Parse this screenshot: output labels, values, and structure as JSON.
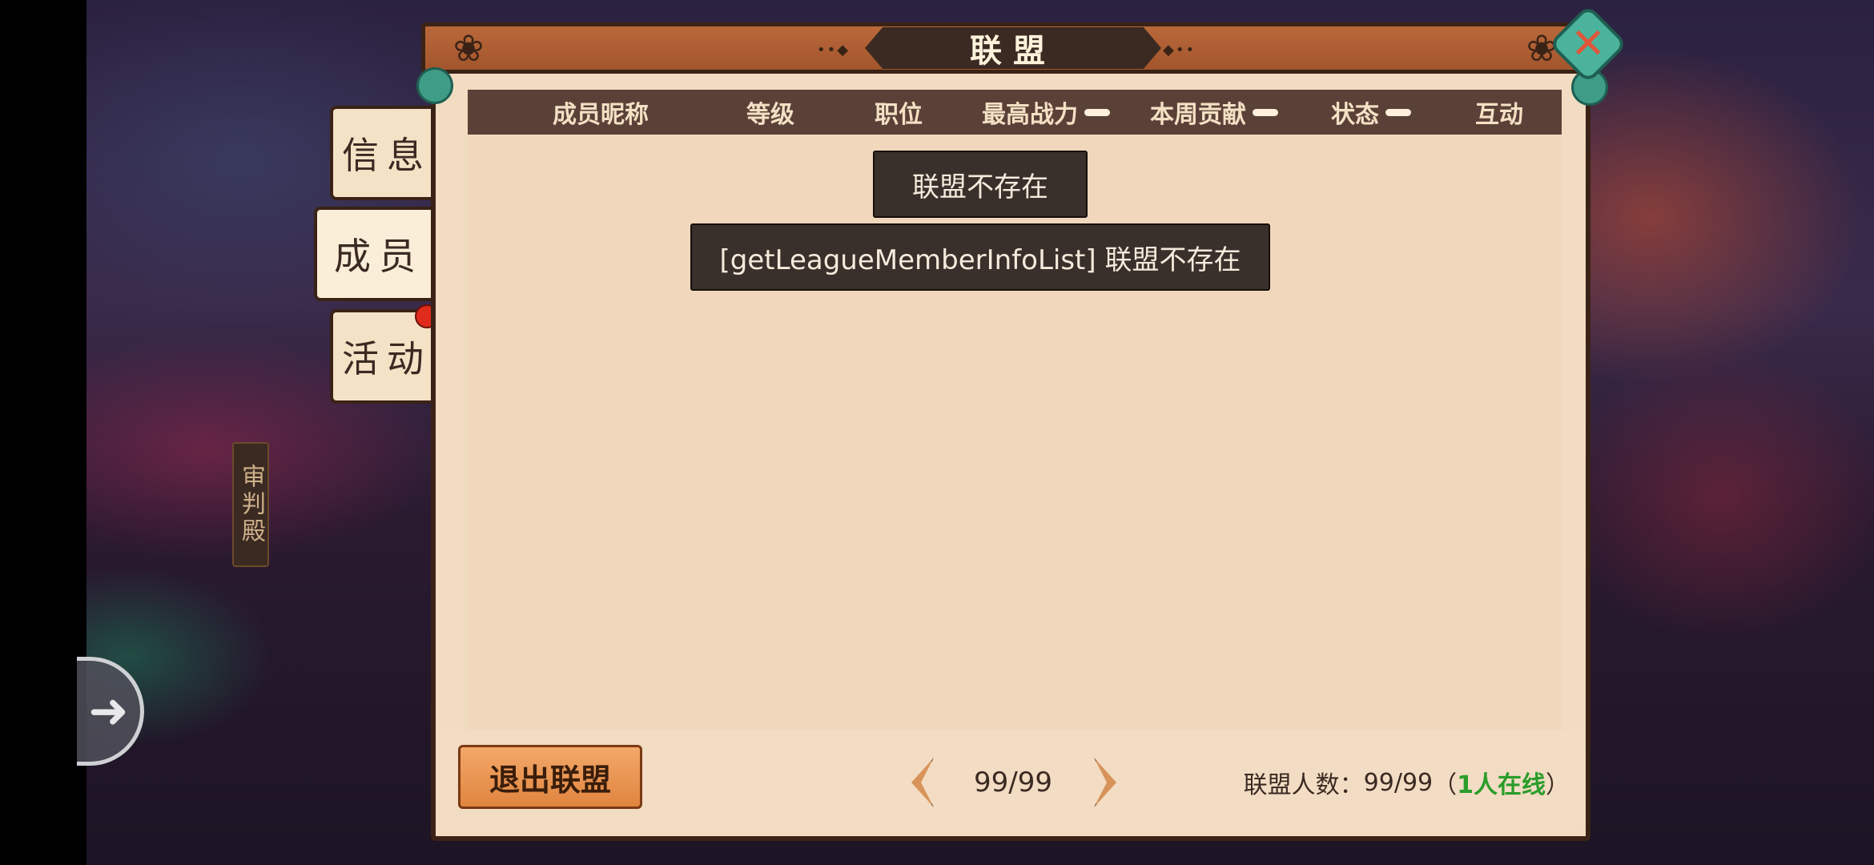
{
  "window": {
    "title": "联盟"
  },
  "side_tabs": [
    {
      "label": "信息",
      "active": false
    },
    {
      "label": "成员",
      "active": true
    },
    {
      "label": "活动",
      "active": false,
      "has_notification": true
    }
  ],
  "world_label": "审判殿",
  "table": {
    "columns": [
      "成员昵称",
      "等级",
      "职位",
      "最高战力",
      "本周贡献",
      "状态",
      "互动"
    ],
    "sortable_columns": [
      "最高战力",
      "本周贡献",
      "状态"
    ],
    "rows": []
  },
  "toasts": [
    "联盟不存在",
    "[getLeagueMemberInfoList] 联盟不存在"
  ],
  "footer": {
    "leave_button": "退出联盟",
    "page_indicator": "99/99",
    "member_count_label": "联盟人数：",
    "member_count_value": "99/99",
    "online_open": "（",
    "online_text": "1人在线",
    "online_close": "）"
  },
  "icons": {
    "close": "close-icon",
    "prev": "chevron-left-icon",
    "next": "chevron-right-icon",
    "left_nav": "arrow-right-icon"
  },
  "colors": {
    "accent": "#e0853f",
    "panel": "#f1dcc1",
    "header": "#5a4138",
    "online": "#2a9d2a",
    "notification": "#e02a1c"
  }
}
